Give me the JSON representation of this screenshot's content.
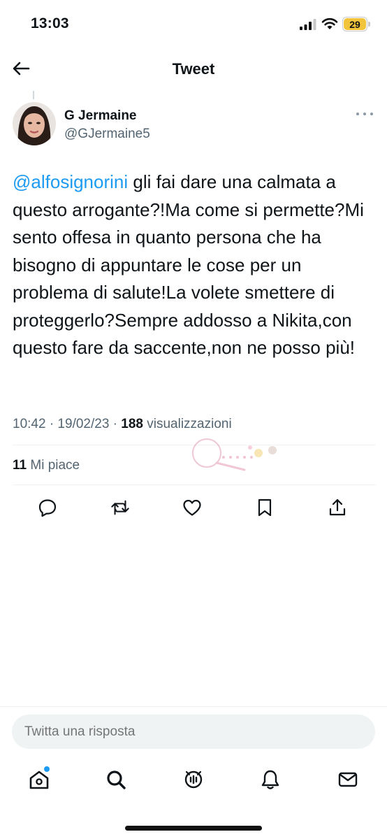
{
  "status_bar": {
    "time": "13:03",
    "battery": "29",
    "battery_fraction": 0.29,
    "battery_color": "#f2c43b"
  },
  "header": {
    "title": "Tweet",
    "back_icon": "arrow-left-icon"
  },
  "tweet": {
    "author_name": "G Jermaine",
    "author_handle": "@GJermaine5",
    "mention": "@alfosignorini",
    "text": " gli fai dare una calmata a questo arrogante?!Ma come si permette?Mi sento offesa in quanto persona che ha bisogno di appuntare le cose per un problema di salute!La volete smettere di proteggerlo?Sempre addosso a Nikita,con questo fare da saccente,non ne posso più!",
    "time_date": "10:42 · 19/02/23 · ",
    "views_count": "188",
    "views_label": " visualizzazioni",
    "likes_count": "11",
    "likes_label": " Mi piace",
    "mention_color": "#1d9bf0"
  },
  "actions": [
    {
      "icon": "reply-icon"
    },
    {
      "icon": "retweet-icon"
    },
    {
      "icon": "like-icon"
    },
    {
      "icon": "bookmark-icon"
    },
    {
      "icon": "share-icon"
    }
  ],
  "reply": {
    "placeholder": "Twitta una risposta"
  },
  "tab_bar": [
    {
      "icon": "home-icon"
    },
    {
      "icon": "search-icon"
    },
    {
      "icon": "spaces-icon"
    },
    {
      "icon": "notifications-icon"
    },
    {
      "icon": "messages-icon"
    }
  ]
}
